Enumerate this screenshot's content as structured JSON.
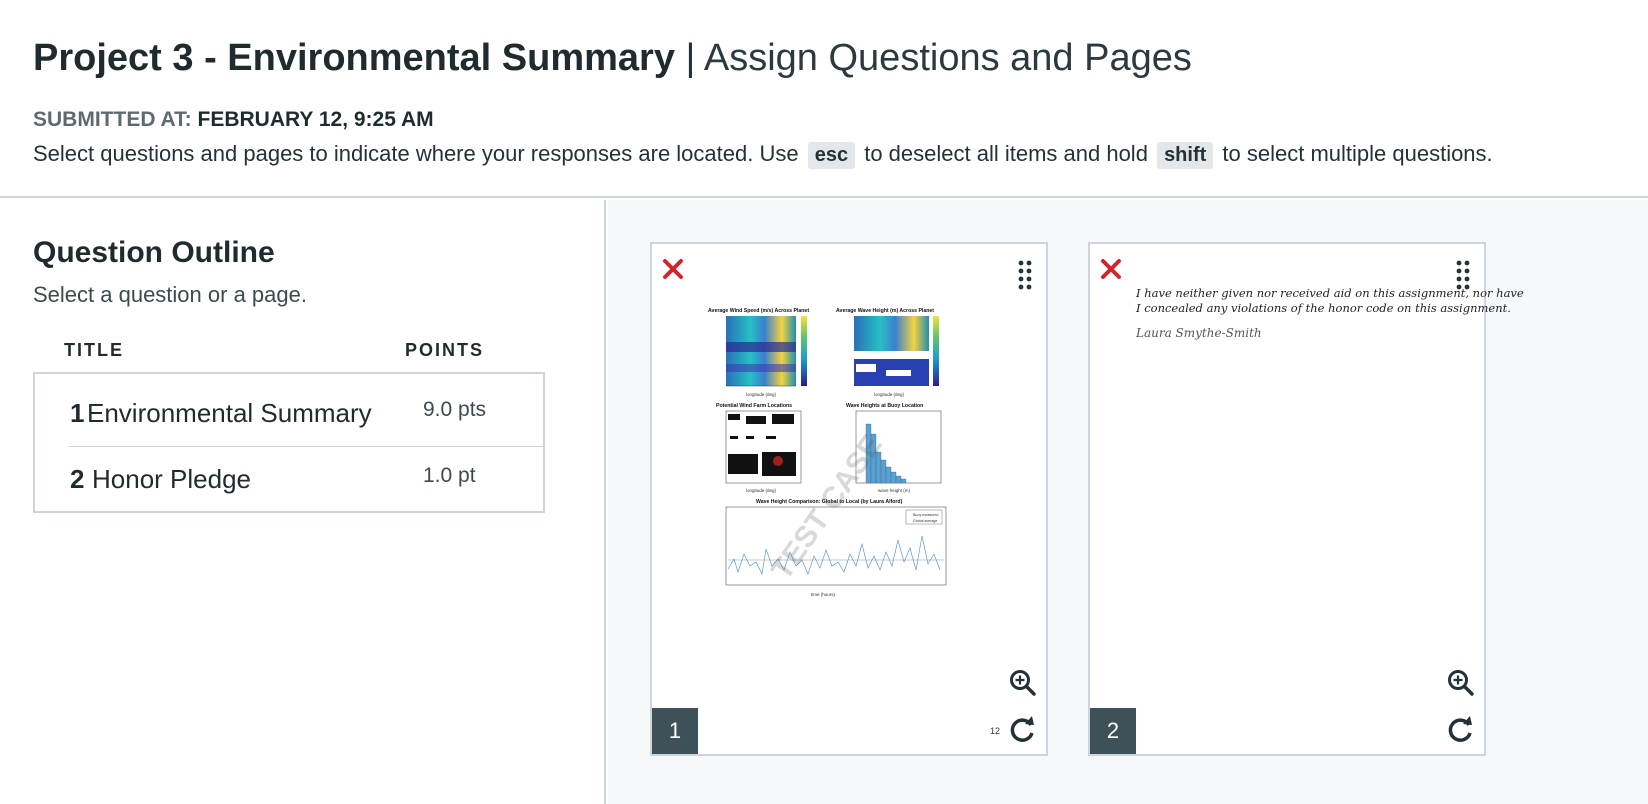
{
  "header": {
    "title_bold": "Project 3 - Environmental Summary",
    "title_sep": " | ",
    "title_light": "Assign Questions and Pages",
    "submitted_label": "SUBMITTED AT:",
    "submitted_value": "FEBRUARY 12, 9:25 AM",
    "instr_1": "Select questions and pages to indicate where your responses are located. Use",
    "key_esc": "esc",
    "instr_2": "to deselect all items and hold",
    "key_shift": "shift",
    "instr_3": "to select multiple questions."
  },
  "outline": {
    "title": "Question Outline",
    "subtitle": "Select a question or a page.",
    "col_title": "TITLE",
    "col_points": "POINTS",
    "questions": [
      {
        "num": "1",
        "title": "Environmental Summary",
        "points": "9.0 pts"
      },
      {
        "num": "2",
        "title": "Honor Pledge",
        "points": "1.0 pt"
      }
    ]
  },
  "pages": [
    {
      "number": "1",
      "footer_num": "12",
      "plots": {
        "p1_title": "Average Wind Speed (m/s) Across Planet",
        "p2_title": "Average Wave Height (m) Across Planet",
        "p3_title": "Potential Wind Farm Locations",
        "p4_title": "Wave Heights at Buoy Location",
        "p5_title": "Wave Height Comparison: Global to Local (by Laura Alford)",
        "legend_1": "Buoy-measured",
        "legend_2": "Global average",
        "watermark": "TEST CASE"
      }
    },
    {
      "number": "2",
      "pledge_line_1": "I have neither given nor received aid on this assignment, nor have",
      "pledge_line_2": "I concealed any violations of the honor code on this assignment.",
      "signature": "Laura Smythe-Smith"
    }
  ],
  "icons": {
    "remove": "close-x-icon",
    "drag": "drag-handle-icon",
    "zoom": "zoom-in-icon",
    "rotate": "rotate-icon"
  },
  "colors": {
    "remove_red": "#d0262b",
    "page_badge": "#3e5158",
    "divider": "#ccd5de",
    "panel_bg": "#f7f8fa"
  }
}
